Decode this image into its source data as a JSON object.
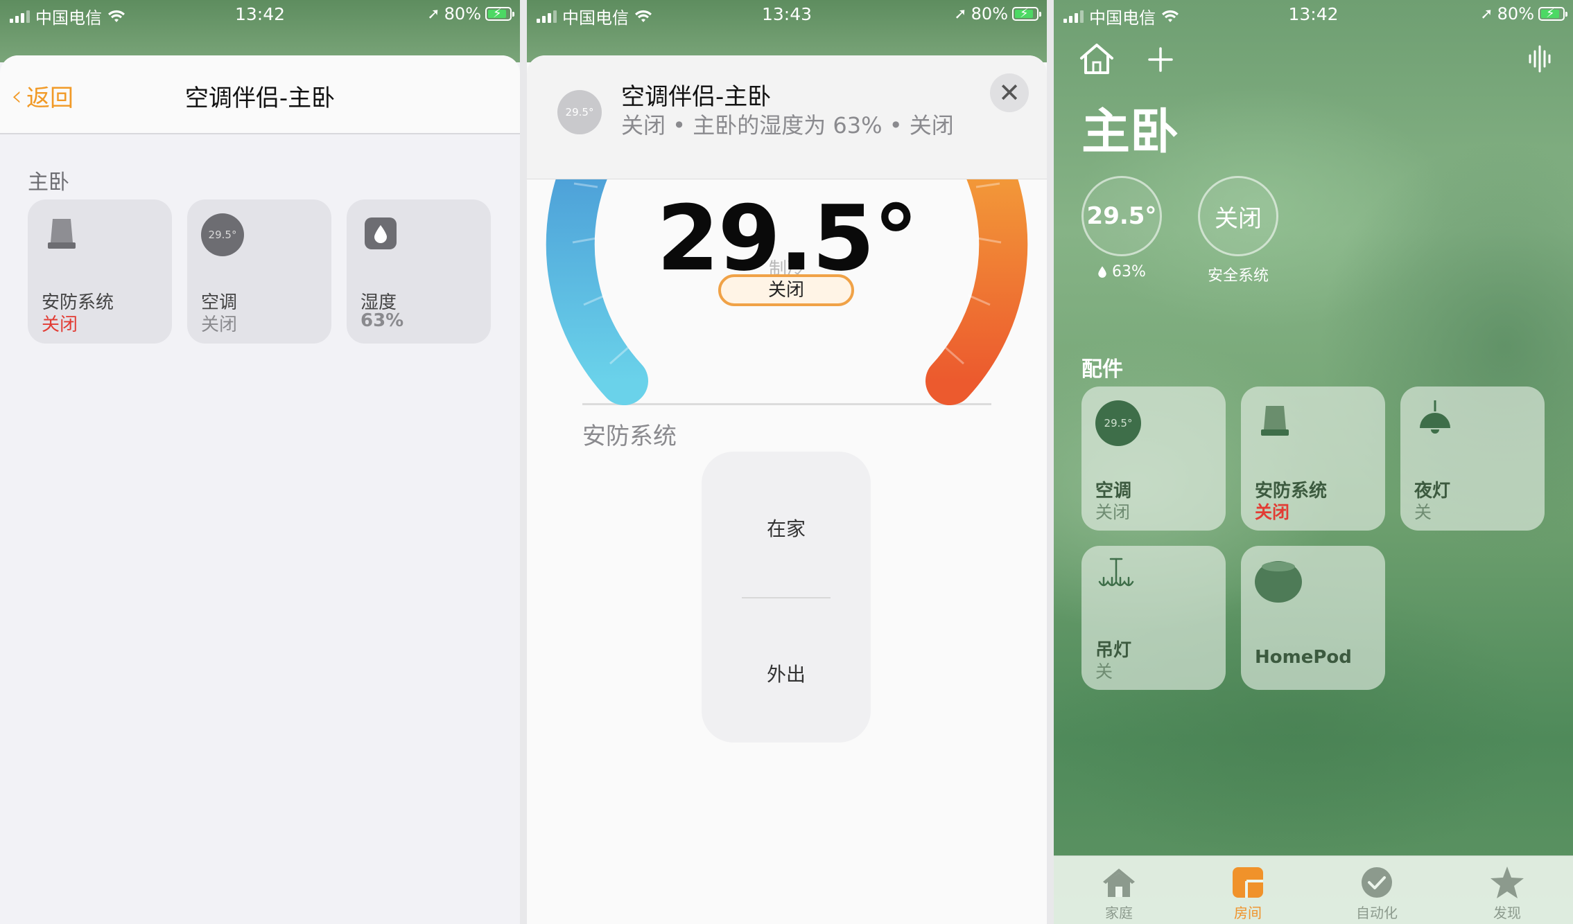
{
  "status_bars": [
    {
      "carrier": "中国电信",
      "time": "13:42",
      "battery": "80%"
    },
    {
      "carrier": "中国电信",
      "time": "13:43",
      "battery": "80%"
    },
    {
      "carrier": "中国电信",
      "time": "13:42",
      "battery": "80%"
    }
  ],
  "panel1": {
    "back_label": "返回",
    "title": "空调伴侣-主卧",
    "section_title": "主卧",
    "tiles": [
      {
        "name": "安防系统",
        "status": "关闭"
      },
      {
        "name": "空调",
        "status": "关闭",
        "temp": "29.5°"
      },
      {
        "name": "湿度",
        "status": "63%"
      }
    ]
  },
  "panel2": {
    "header": {
      "badge": "29.5°",
      "title": "空调伴侣-主卧",
      "subtitle": "关闭 • 主卧的湿度为 63% • 关闭"
    },
    "temperature": "29.5°",
    "mode_label": "制冷",
    "power_label": "关闭",
    "security_section_title": "安防系统",
    "security_options": [
      "在家",
      "外出"
    ]
  },
  "panel3": {
    "room_title": "主卧",
    "summary": {
      "temp": "29.5°",
      "humidity": "63%",
      "security_value": "关闭",
      "security_label": "安全系统"
    },
    "section_title": "配件",
    "tiles": [
      {
        "name": "空调",
        "status": "关闭",
        "badge": "29.5°"
      },
      {
        "name": "安防系统",
        "status": "关闭"
      },
      {
        "name": "夜灯",
        "status": "关"
      },
      {
        "name": "吊灯",
        "status": "关"
      },
      {
        "name": "HomePod",
        "status": ""
      }
    ],
    "tabs": [
      {
        "label": "家庭",
        "icon": "house-icon"
      },
      {
        "label": "房间",
        "icon": "rooms-icon",
        "active": true
      },
      {
        "label": "自动化",
        "icon": "automation-icon"
      },
      {
        "label": "发现",
        "icon": "star-icon"
      }
    ]
  },
  "colors": {
    "accent": "#f19a27",
    "alert_red": "#e23c34",
    "cool_blue": "#4aa6dc",
    "warm_orange": "#f0762c"
  }
}
